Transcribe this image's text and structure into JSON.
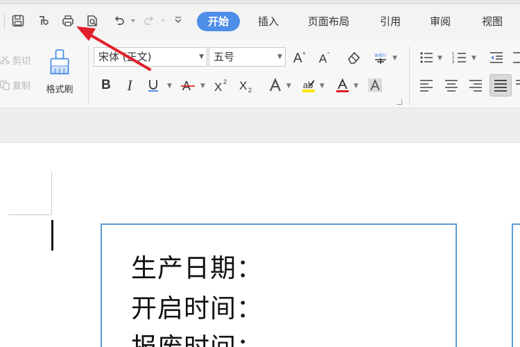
{
  "tabs": [
    {
      "label": "开始",
      "active": true
    },
    {
      "label": "插入"
    },
    {
      "label": "页面布局"
    },
    {
      "label": "引用"
    },
    {
      "label": "审阅"
    },
    {
      "label": "视图"
    }
  ],
  "clipboard": {
    "cut_label": "剪切",
    "copy_label": "复制",
    "format_painter_label": "格式刷"
  },
  "font": {
    "family": "宋体 (正文)",
    "size": "五号"
  },
  "document": {
    "lines": [
      "生产日期：",
      "开启时间：",
      "报废时间："
    ]
  },
  "colors": {
    "accent": "#4e8ee8",
    "label_border": "#5b9bd5",
    "annotation_arrow": "#e0202a",
    "highlight": "#ffe600",
    "font_color_bar": "#e02020"
  },
  "icons": {
    "quick_access": [
      "save-icon",
      "format-painter-quick-icon",
      "print-icon",
      "print-preview-icon",
      "undo-icon",
      "redo-icon",
      "customize-qat-icon"
    ]
  }
}
